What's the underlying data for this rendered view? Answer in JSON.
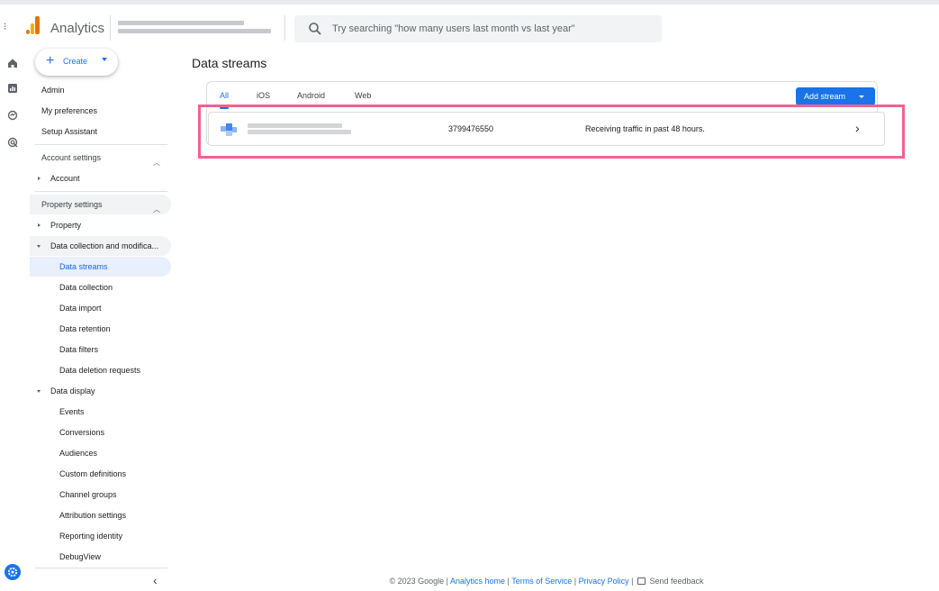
{
  "header": {
    "app_name": "Analytics",
    "search_placeholder": "Try searching \"how many users last month vs last year\""
  },
  "nav": {
    "create_label": "Create",
    "top_items": [
      {
        "label": "Admin"
      },
      {
        "label": "My preferences"
      },
      {
        "label": "Setup Assistant"
      }
    ],
    "account_settings": {
      "label": "Account settings",
      "items": [
        {
          "label": "Account"
        }
      ]
    },
    "property_settings": {
      "label": "Property settings",
      "property": "Property",
      "data_collection_group": "Data collection and modifica...",
      "data_collection_items": [
        {
          "label": "Data streams",
          "active": true
        },
        {
          "label": "Data collection"
        },
        {
          "label": "Data import"
        },
        {
          "label": "Data retention"
        },
        {
          "label": "Data filters"
        },
        {
          "label": "Data deletion requests"
        }
      ],
      "data_display_group": "Data display",
      "data_display_items": [
        {
          "label": "Events"
        },
        {
          "label": "Conversions"
        },
        {
          "label": "Audiences"
        },
        {
          "label": "Custom definitions"
        },
        {
          "label": "Channel groups"
        },
        {
          "label": "Attribution settings"
        },
        {
          "label": "Reporting identity"
        },
        {
          "label": "DebugView"
        }
      ]
    }
  },
  "main": {
    "title": "Data streams",
    "tabs": [
      {
        "label": "All",
        "active": true
      },
      {
        "label": "iOS"
      },
      {
        "label": "Android"
      },
      {
        "label": "Web"
      }
    ],
    "add_stream_label": "Add stream",
    "stream": {
      "id": "3799476550",
      "status": "Receiving traffic in past 48 hours."
    }
  },
  "footer": {
    "copyright": "© 2023 Google |",
    "analytics_home": "Analytics home",
    "terms": "Terms of Service",
    "privacy": "Privacy Policy",
    "feedback": "Send feedback"
  },
  "colors": {
    "accent": "#1a73e8",
    "highlight": "#f06292",
    "active_nav_bg": "#e8f0fe"
  }
}
